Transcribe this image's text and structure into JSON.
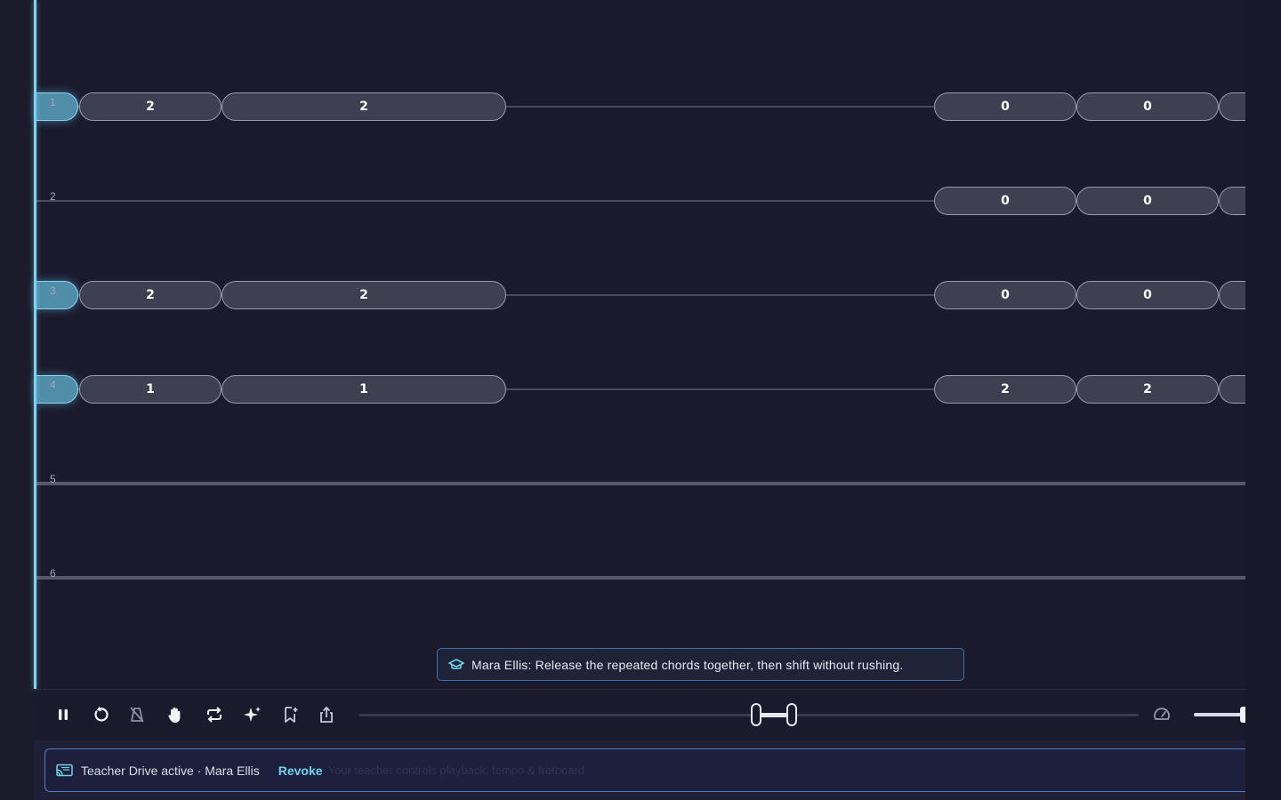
{
  "fretboard": {
    "strings": [
      {
        "label": "1",
        "active": true,
        "notes": [
          "2",
          "2",
          "0",
          "0"
        ]
      },
      {
        "label": "2",
        "active": false,
        "notes": [
          "0",
          "0"
        ]
      },
      {
        "label": "3",
        "active": true,
        "notes": [
          "2",
          "2",
          "0",
          "0"
        ]
      },
      {
        "label": "4",
        "active": true,
        "notes": [
          "1",
          "1",
          "2",
          "2"
        ]
      },
      {
        "label": "5",
        "active": false,
        "notes": []
      },
      {
        "label": "6",
        "active": false,
        "notes": []
      }
    ]
  },
  "tooltip": {
    "icon": "graduation-cap-icon",
    "text": "Mara Ellis: Release the repeated chords together, then shift without rushing."
  },
  "toolbar": {
    "icons": [
      "pause-icon",
      "restart-icon",
      "metronome-off-icon",
      "hand-icon",
      "loop-icon",
      "sparkle-icon",
      "bookmark-add-icon",
      "share-icon",
      "speed-gauge-icon"
    ]
  },
  "banner": {
    "icon": "cast-icon",
    "status": "Teacher Drive active · Mara Ellis",
    "action": "Revoke",
    "ghost_text": "Your teacher controls playback, tempo & fretboard"
  },
  "colors": {
    "background": "#1b1a2d",
    "accent": "#6fd3ee",
    "playhead": "#7fd3f0"
  }
}
